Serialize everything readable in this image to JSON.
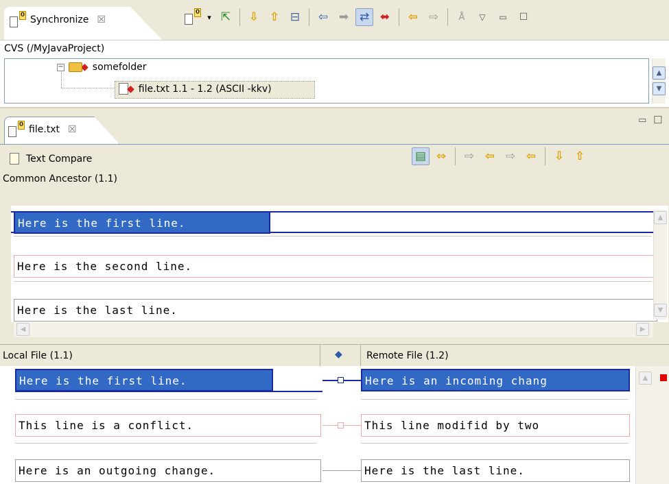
{
  "sync_view": {
    "tab_label": "Synchronize",
    "close_glyph": "☒",
    "tree_root": "CVS (/MyJavaProject)",
    "folder_name": "somefolder",
    "file_row": "file.txt  1.1 - 1.2  (ASCII -kkv)",
    "toolbar_icons": [
      "synchronize-icon",
      "dropdown-arrow-icon",
      "commit-icon",
      "next-diff-icon",
      "previous-diff-icon",
      "collapse-all-icon",
      "incoming-mode-icon",
      "outgoing-mode-icon",
      "both-mode-icon",
      "conflicts-mode-icon",
      "copy-left-icon",
      "copy-right-icon",
      "remove-icon",
      "view-menu-icon",
      "minimize-icon",
      "maximize-icon"
    ]
  },
  "editor": {
    "tab_label": "file.txt",
    "close_glyph": "☒",
    "compare_title": "Text Compare",
    "ancestor_label": "Common Ancestor (1.1)",
    "ancestor_lines": [
      "Here is the first line.",
      "Here is the second line.",
      "Here is the last line."
    ],
    "local_label": "Local File (1.1)",
    "remote_label": "Remote File (1.2)",
    "local_lines": [
      "Here is the first line.",
      "This line is a conflict.",
      "Here is an outgoing change."
    ],
    "remote_lines": [
      "Here is an incoming chang",
      "This line modifid by two",
      "Here is the last line."
    ]
  },
  "colors": {
    "selection": "#3269c4",
    "conflict_border": "#f3a8a8",
    "incoming_blue": "#1a2aa0"
  }
}
